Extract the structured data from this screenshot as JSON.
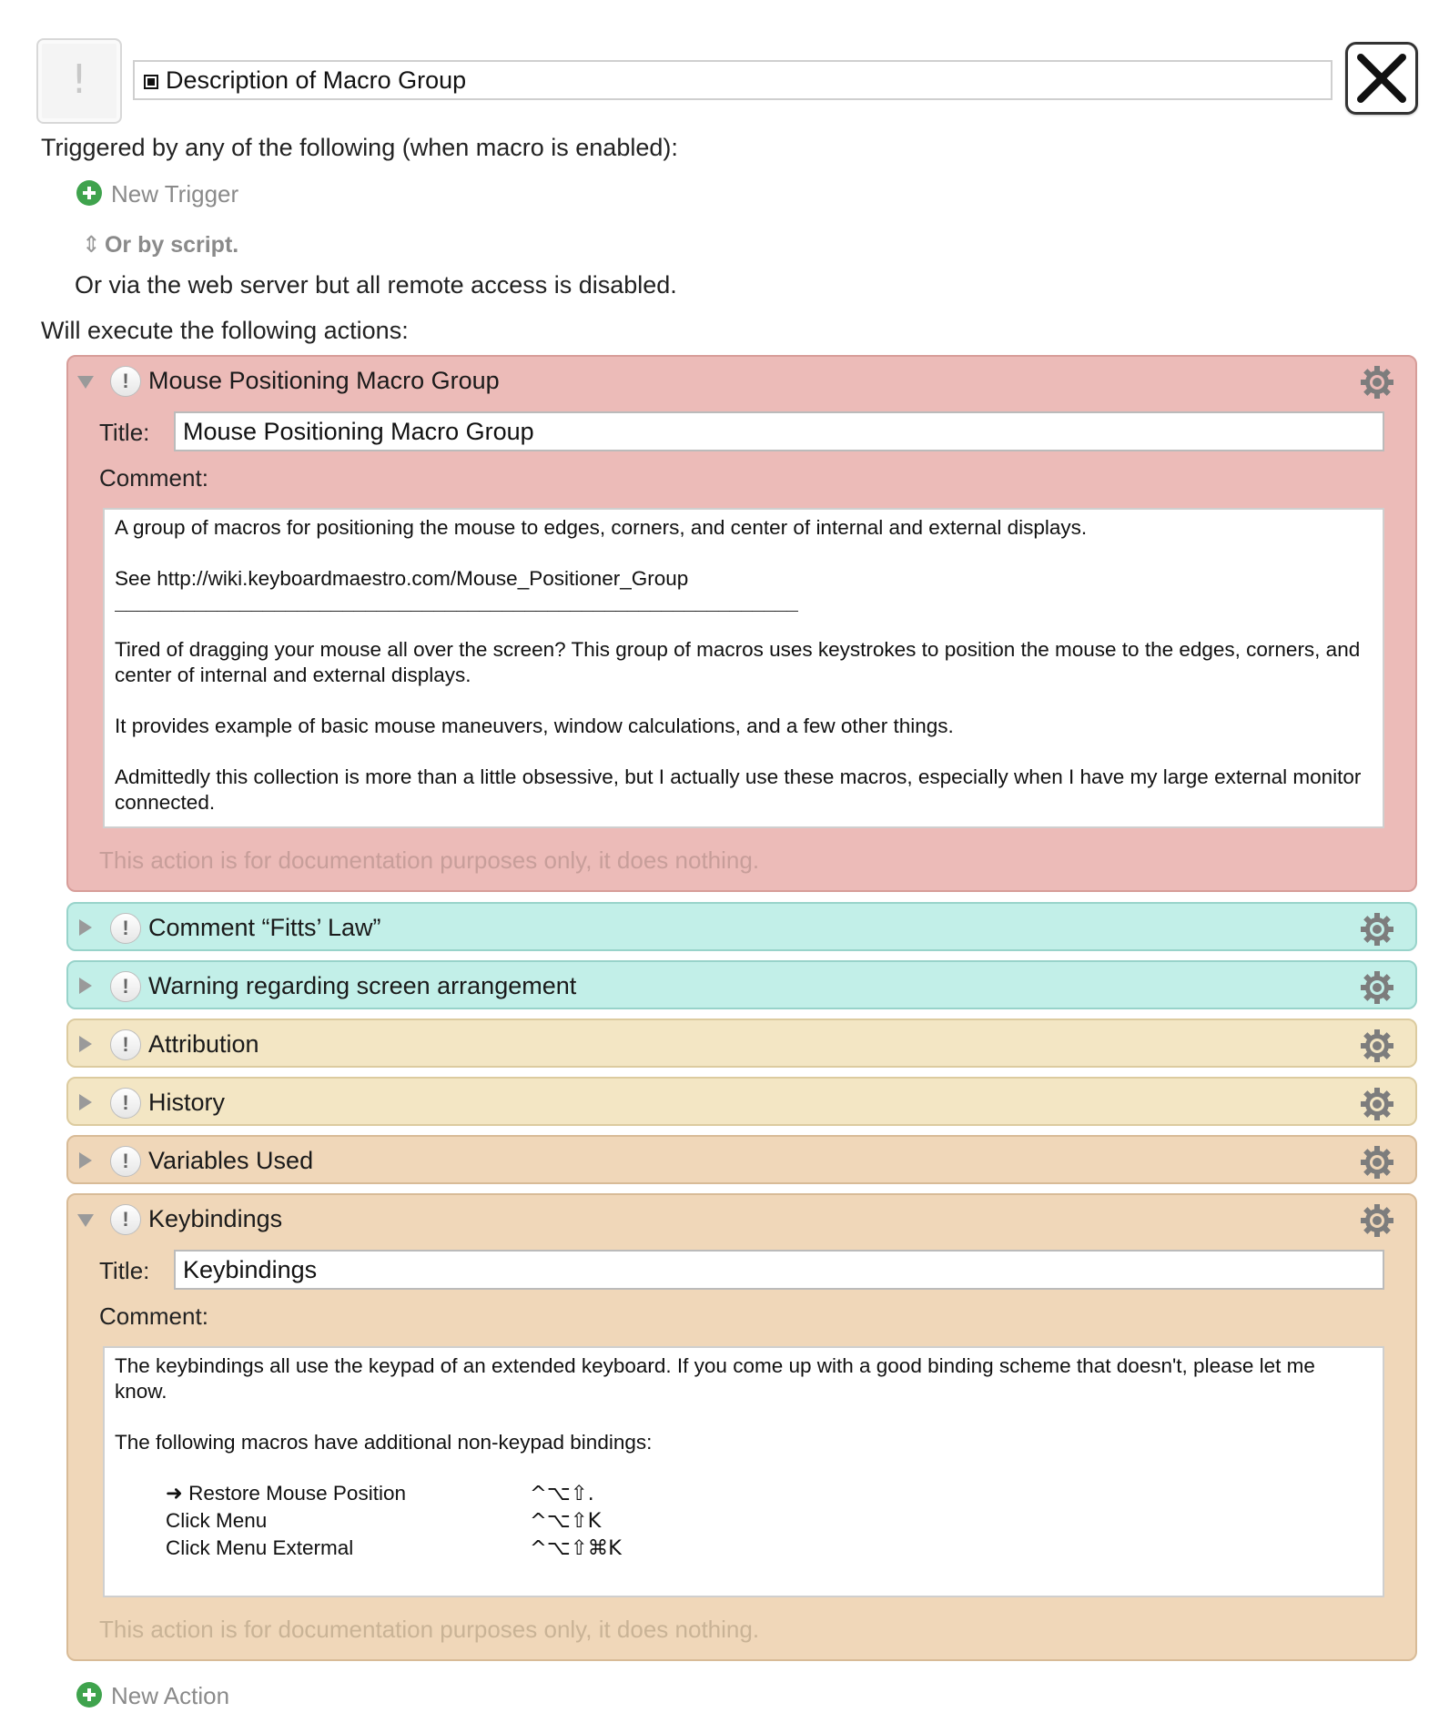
{
  "header": {
    "macro_name": "Description of Macro Group"
  },
  "triggers": {
    "heading": "Triggered by any of the following (when macro is enabled):",
    "new_trigger_label": "New Trigger",
    "by_script_label": "Or by script.",
    "web_server_text": "Or via the web server but all remote access is disabled."
  },
  "actions": {
    "heading": "Will execute the following actions:",
    "new_action_label": "New Action",
    "field_labels": {
      "title": "Title:",
      "comment": "Comment:"
    },
    "doc_note": "This action is for documentation purposes only, it does nothing.",
    "items": [
      {
        "title": "Mouse Positioning Macro Group",
        "expanded": true,
        "color": "#ecbbb8",
        "title_value": "Mouse Positioning Macro Group",
        "comment_lines": [
          "A group of macros for positioning the mouse to edges, corners, and center of internal and external displays.",
          "",
          "See http://wiki.keyboardmaestro.com/Mouse_Positioner_Group",
          "____________________________________________________________",
          "",
          "Tired of dragging your mouse all over the screen? This group of macros uses keystrokes to position the mouse to the edges, corners, and center of internal and external displays.",
          "",
          "It provides example of basic mouse maneuvers, window calculations, and a few other things.",
          "",
          "Admittedly this collection is more than a little obsessive, but I actually use these macros, especially when I have my large external monitor connected."
        ]
      },
      {
        "title": "Comment “Fitts’ Law”",
        "expanded": false,
        "color": "#c2efe8"
      },
      {
        "title": "Warning regarding screen arrangement",
        "expanded": false,
        "color": "#c2efe8"
      },
      {
        "title": "Attribution",
        "expanded": false,
        "color": "#f3e6c4"
      },
      {
        "title": "History",
        "expanded": false,
        "color": "#f3e6c4"
      },
      {
        "title": "Variables Used",
        "expanded": false,
        "color": "#f0d7b9"
      },
      {
        "title": "Keybindings",
        "expanded": true,
        "color": "#f0d7b9",
        "title_value": "Keybindings",
        "comment_intro": "The keybindings all use the keypad of an extended keyboard. If you come up with a good binding scheme that doesn't, please let me know.",
        "comment_subhead": "The following macros have additional non-keypad bindings:",
        "bindings": [
          {
            "macro": "➜ Restore Mouse Position",
            "keys": "^⌥⇧."
          },
          {
            "macro": "Click  Menu",
            "keys": "^⌥⇧K"
          },
          {
            "macro": "Click  Menu Extermal",
            "keys": "^⌥⇧⌘K"
          }
        ]
      }
    ]
  }
}
